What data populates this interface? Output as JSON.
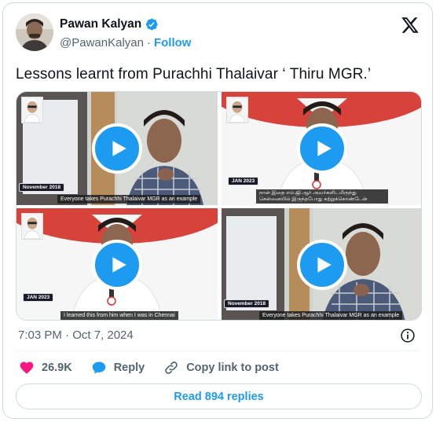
{
  "author": {
    "name": "Pawan Kalyan",
    "handle": "@PawanKalyan",
    "separator": "·",
    "follow_label": "Follow",
    "verified": true
  },
  "tweet": {
    "text": "Lessons learnt from Purachhi Thalaivar ‘ Thiru MGR.’",
    "timestamp": "7:03 PM · Oct 7, 2024"
  },
  "media": [
    {
      "date_tag": "November 2018",
      "caption": "Everyone takes Purachhi Thalaivar MGR as an example"
    },
    {
      "date_tag": "JAN 2023",
      "caption": "நான் இதை எம்.ஜி.ஆர் அவர்களிடமிருந்து சென்னையில் இருந்தபோது கற்றுக்கொண்டேன்"
    },
    {
      "date_tag": "JAN 2023",
      "caption": "I learned this from him when I was in Chennai"
    },
    {
      "date_tag": "November 2018",
      "caption": "Everyone takes Purachhi Thalaivar MGR as an example"
    }
  ],
  "actions": {
    "likes": "26.9K",
    "reply_label": "Reply",
    "copy_label": "Copy link to post"
  },
  "replies_button": "Read 894 replies",
  "colors": {
    "accent": "#1d9bf0",
    "like": "#f91880",
    "muted": "#536471"
  }
}
